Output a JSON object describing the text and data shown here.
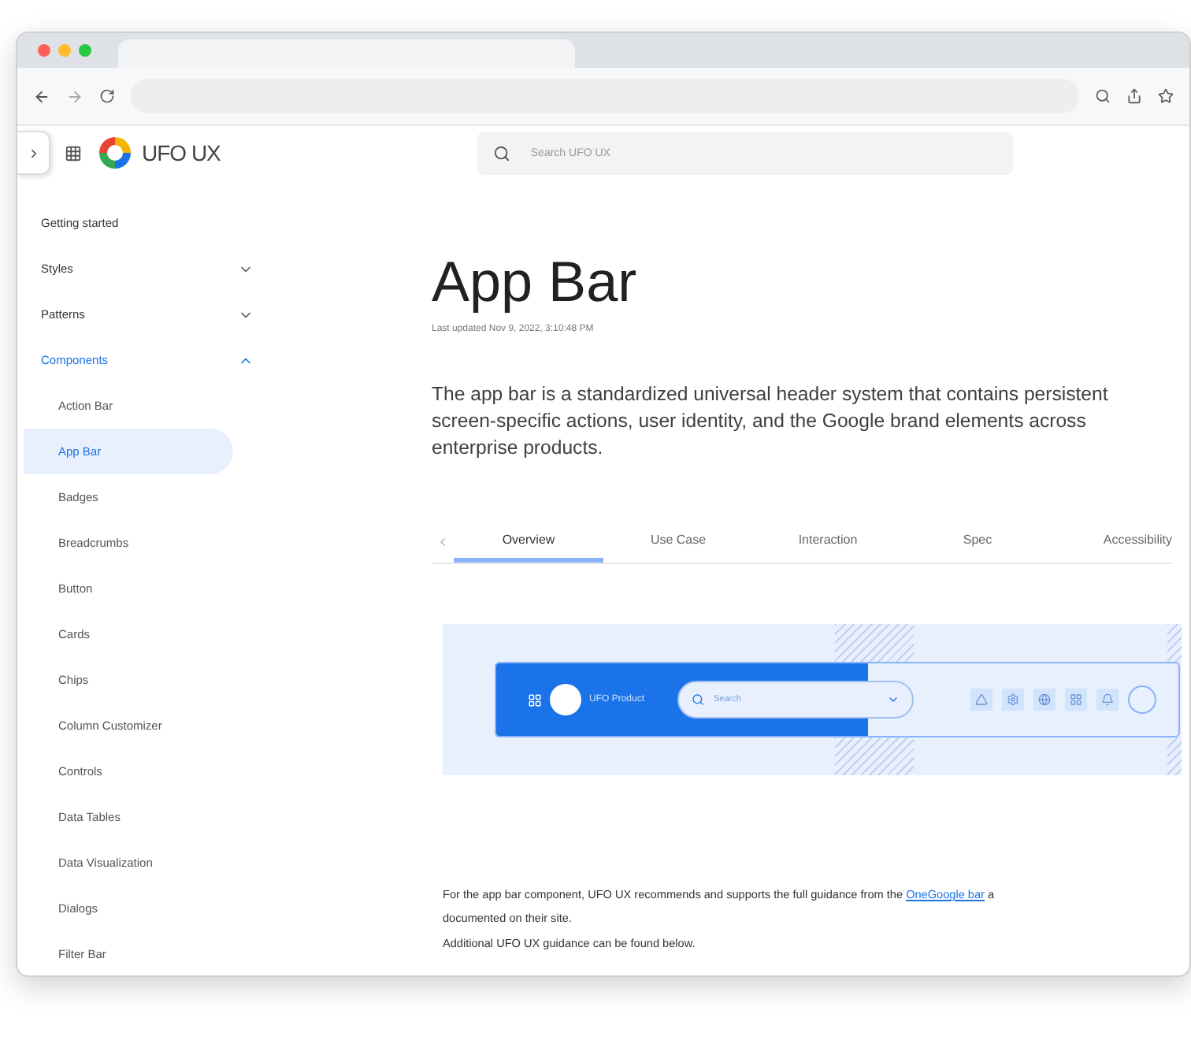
{
  "site": {
    "name": "UFO UX",
    "search": {
      "placeholder": "Search UFO UX"
    }
  },
  "sidebar": {
    "items": [
      {
        "label": "Getting started"
      },
      {
        "label": "Styles",
        "expanded": false
      },
      {
        "label": "Patterns",
        "expanded": false
      },
      {
        "label": "Components",
        "expanded": true,
        "children": [
          {
            "label": "Action Bar",
            "selected": false
          },
          {
            "label": "App Bar",
            "selected": true
          },
          {
            "label": "Badges",
            "selected": false
          },
          {
            "label": "Breadcrumbs",
            "selected": false
          },
          {
            "label": "Button",
            "selected": false
          },
          {
            "label": "Cards",
            "selected": false
          },
          {
            "label": "Chips",
            "selected": false
          },
          {
            "label": "Column Customizer",
            "selected": false
          },
          {
            "label": "Controls",
            "selected": false
          },
          {
            "label": "Data Tables",
            "selected": false
          },
          {
            "label": "Data Visualization",
            "selected": false
          },
          {
            "label": "Dialogs",
            "selected": false
          },
          {
            "label": "Filter Bar",
            "selected": false
          }
        ]
      }
    ]
  },
  "page": {
    "title": "App Bar",
    "updated": "Last updated Nov 9, 2022, 3:10:48 PM",
    "description": "The app bar is a standardized universal header system that contains persistent screen-specific actions, user identity, and the Google brand elements across enterprise products.",
    "tabs": [
      {
        "label": "Overview",
        "selected": true
      },
      {
        "label": "Use Case",
        "selected": false
      },
      {
        "label": "Interaction",
        "selected": false
      },
      {
        "label": "Spec",
        "selected": false
      },
      {
        "label": "Accessibility",
        "selected": false
      }
    ],
    "illustration": {
      "product": "UFO Product",
      "search": "Search"
    },
    "guidance": {
      "before": "For the app bar component, UFO UX recommends and supports the full guidance from the ",
      "link": "OneGoogle bar",
      "after": " a",
      "line2": "documented on their site."
    },
    "note": "Additional UFO UX guidance can be found below."
  }
}
